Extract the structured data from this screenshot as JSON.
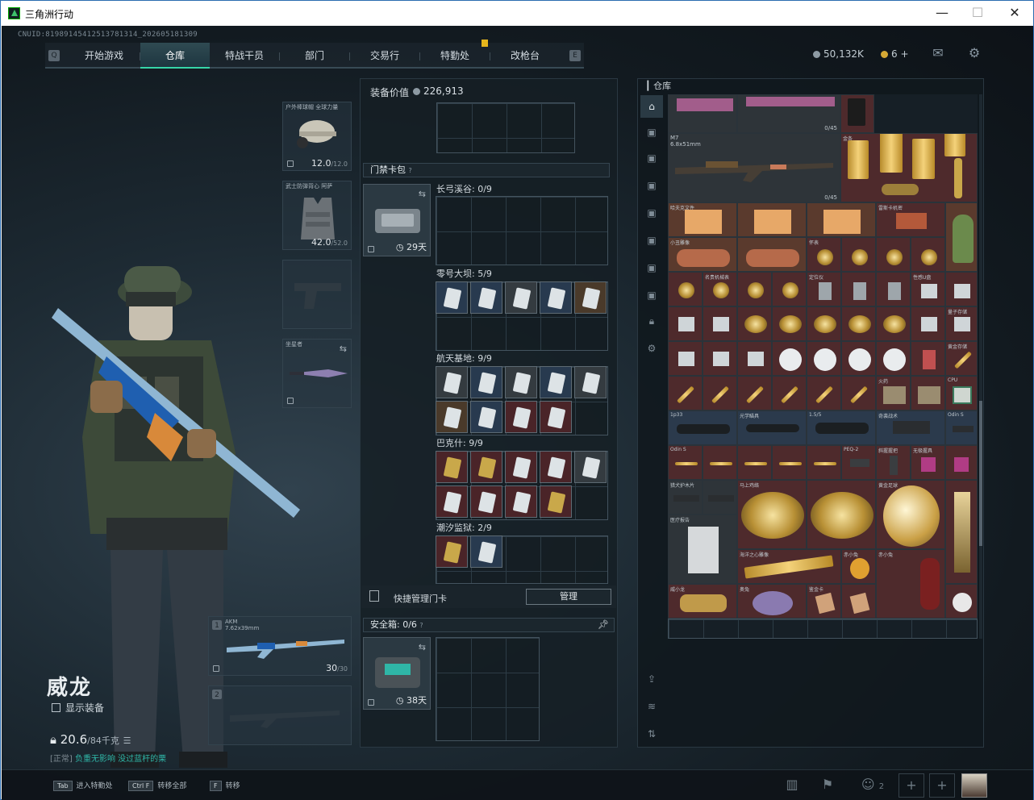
{
  "window": {
    "title": "三角洲行动",
    "minimize": "—",
    "maximize": "☐",
    "close": "✕"
  },
  "uid": "CNUID:8198914541251378131​4_2026051813​09",
  "nav": {
    "tabs": [
      "开始游戏",
      "仓库",
      "特战干员",
      "部门",
      "交易行",
      "特勤处",
      "改枪台"
    ],
    "active": "仓库",
    "left_key": "Q",
    "right_key": "E"
  },
  "currency": {
    "coins": "50,132K",
    "tokens": "6",
    "plus": "+"
  },
  "equipment": {
    "helmet": {
      "label": "户外棒球帽 全球力量",
      "durability": "12.0",
      "max": "/12.0"
    },
    "armor": {
      "label": "武士防弹背心 阿萨",
      "durability": "42.0",
      "max": "/52.0"
    },
    "melee": {
      "label": "坐星者"
    },
    "primary": {
      "name": "AKM",
      "caliber": "7.62x39mm",
      "ammo": "30",
      "ammo_max": "/30",
      "slot": "1"
    },
    "secondary": {
      "slot": "2"
    }
  },
  "operator": {
    "name": "威龙",
    "show_equipment": "显示装备",
    "weight": "20.6",
    "weight_max": "/84千克",
    "note_prefix": "[正常]",
    "note": "负重无影响 没过蓝杆的栗"
  },
  "loadout": {
    "title": "装备价值",
    "value": "226,913",
    "keycard_section": "门禁卡包",
    "keycard_help": "?",
    "keycard_time": "29天",
    "maps": [
      {
        "label": "长弓溪谷: 0/9"
      },
      {
        "label": "零号大坝: 5/9"
      },
      {
        "label": "航天基地: 9/9"
      },
      {
        "label": "巴克什: 9/9"
      },
      {
        "label": "潮汐监狱: 2/9"
      }
    ],
    "quick_manage": "快捷管理门卡",
    "manage_button": "管理",
    "safebox": {
      "title": "安全箱:",
      "count": "0/6",
      "help": "?",
      "time": "38天"
    }
  },
  "stash": {
    "title": "仓库",
    "weapon": {
      "name": "M7",
      "caliber": "6.8x51mm",
      "count": "0/45"
    },
    "count_top": "0/45",
    "item_labels": [
      "金条",
      "香槟",
      "哈夫克文件",
      "雷斯卡机密",
      "小丑雕像",
      "怀表",
      "名贵机械表",
      "定位仪",
      "性感U盘",
      "量子存储",
      "黄金存储",
      "火药",
      "CPU",
      "1p33",
      "光学瞄具",
      "1.5/5",
      "奇袭战术",
      "Odin S",
      "PEQ-2",
      "斜握握把",
      "无极握具",
      "猎犬护木片",
      "马上鸡络",
      "黄金足球",
      "医疗报告",
      "海洋之心雕像",
      "赤小兔",
      "威小龙",
      "奥兔",
      "鉴金卡"
    ]
  },
  "bottom": {
    "hints": [
      {
        "key": "Tab",
        "text": "进入特勤处"
      },
      {
        "key": "Ctrl F",
        "text": "转移全部"
      },
      {
        "key": "F",
        "text": "转移"
      }
    ],
    "friends": "2"
  }
}
